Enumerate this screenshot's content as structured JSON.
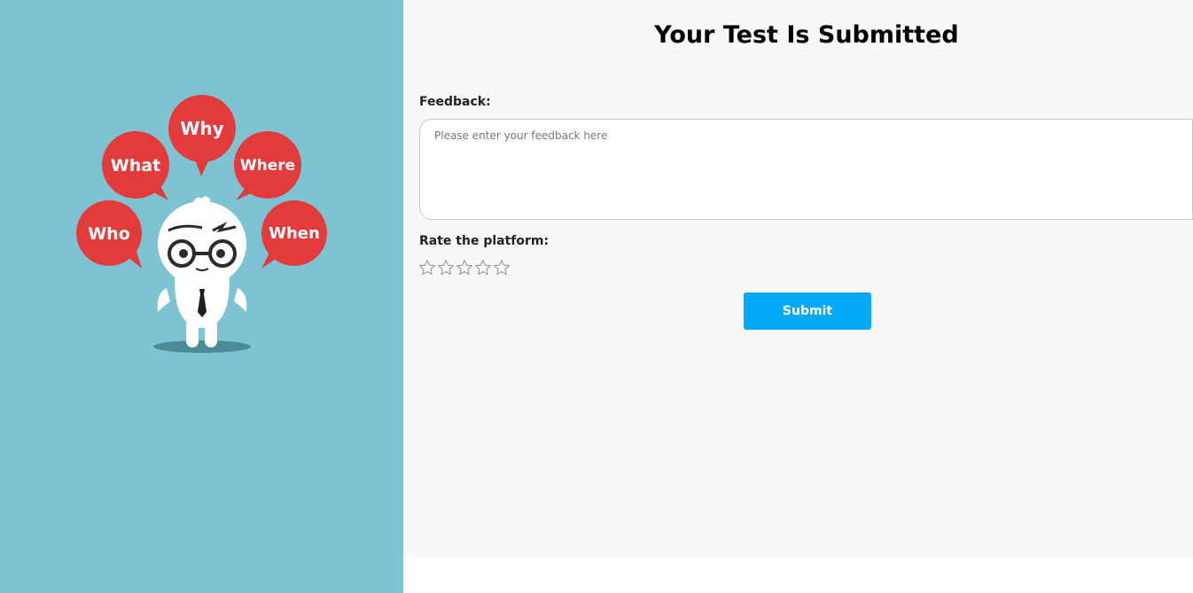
{
  "page": {
    "title": "Your Test Is Submitted"
  },
  "illustration": {
    "bubbles": [
      "Why",
      "What",
      "Where",
      "Who",
      "When"
    ],
    "colors": {
      "background": "#7dc3d4",
      "bubble": "#e33b3b",
      "shadow": "#4c8a96"
    }
  },
  "form": {
    "feedback_label": "Feedback:",
    "feedback_value": "",
    "feedback_placeholder": "Please enter your feedback here",
    "rating_label": "Rate the platform:",
    "rating": {
      "value": 0,
      "max": 5,
      "icon": "star-outline-icon"
    },
    "submit_label": "Submit"
  },
  "colors": {
    "accent": "#03a9f4"
  }
}
